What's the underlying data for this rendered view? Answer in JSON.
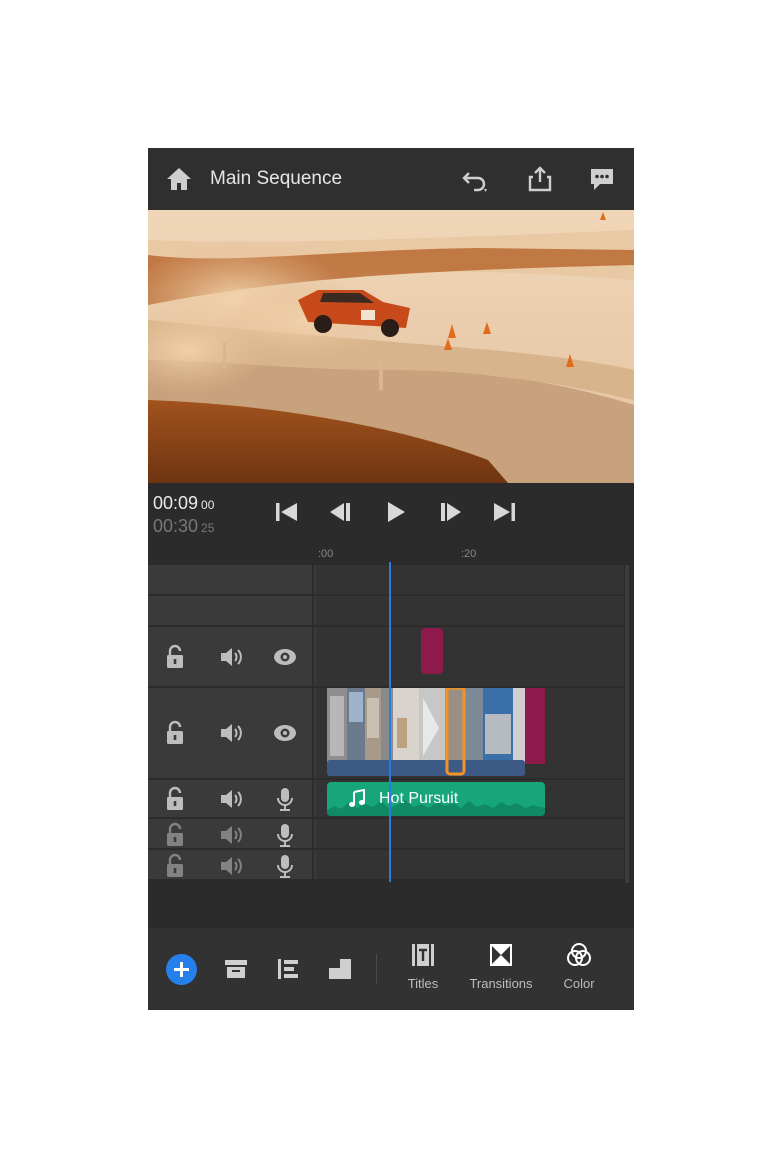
{
  "header": {
    "title": "Main Sequence",
    "icons": [
      "home-icon",
      "undo-icon",
      "share-icon",
      "comment-icon"
    ]
  },
  "preview": {
    "description_icon": "video-preview"
  },
  "transport": {
    "current_time": "00:09",
    "current_frames": "00",
    "duration": "00:30",
    "duration_frames": "25",
    "buttons": [
      "skip-to-start",
      "step-back",
      "play",
      "step-forward",
      "skip-to-end"
    ]
  },
  "ruler": {
    "marks": [
      ":00",
      ":20"
    ]
  },
  "tracks": {
    "audio_clip_label": "Hot Pursuit"
  },
  "toolbar": {
    "titles_label": "Titles",
    "transitions_label": "Transitions",
    "color_label": "Color"
  },
  "colors": {
    "accent_blue": "#2d7bd8",
    "add_button": "#2680eb",
    "audio_clip": "#17a57a",
    "title_clip": "#8d1a4a",
    "selection": "#f29423"
  }
}
